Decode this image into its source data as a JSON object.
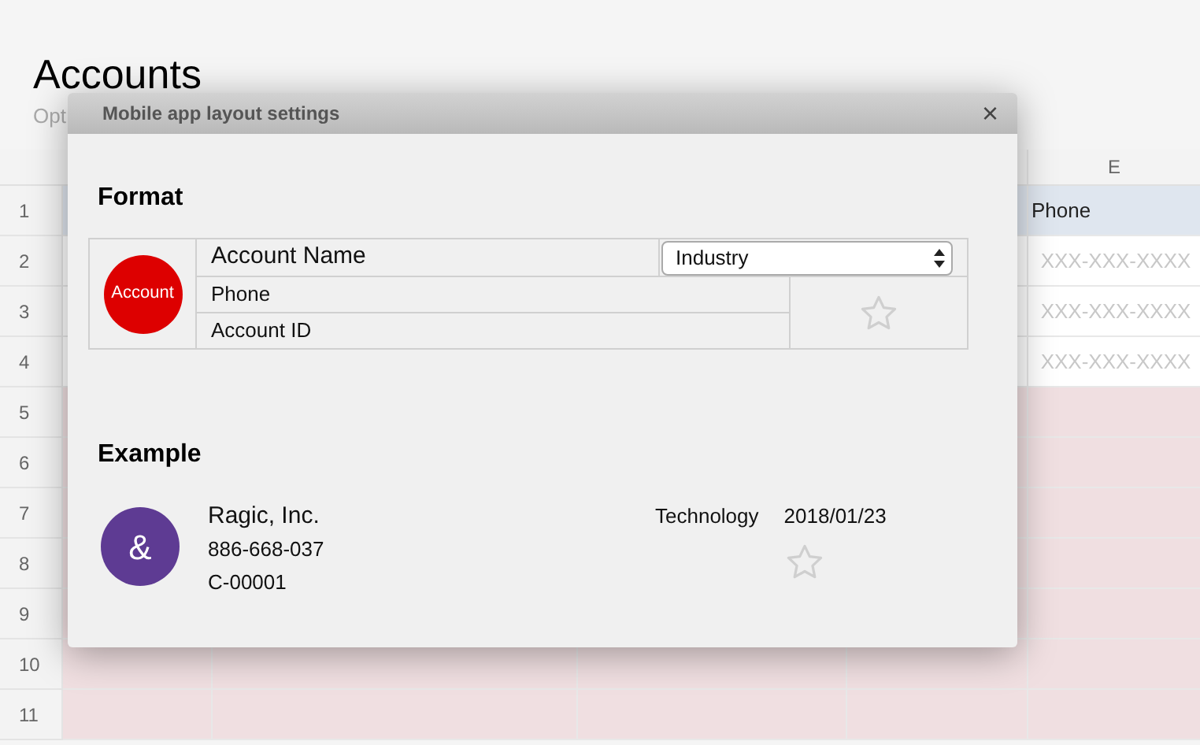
{
  "page": {
    "title": "Accounts",
    "subtitle": "Opt"
  },
  "sheet": {
    "column_header": "E",
    "rows": [
      {
        "number": "1",
        "kind": "heading",
        "text": "Phone"
      },
      {
        "number": "2",
        "kind": "placeholder",
        "text": "XXX-XXX-XXXX"
      },
      {
        "number": "3",
        "kind": "placeholder",
        "text": "XXX-XXX-XXXX"
      },
      {
        "number": "4",
        "kind": "placeholder",
        "text": "XXX-XXX-XXXX"
      },
      {
        "number": "5",
        "kind": "blank"
      },
      {
        "number": "6",
        "kind": "blank"
      },
      {
        "number": "7",
        "kind": "blank"
      },
      {
        "number": "8",
        "kind": "blank"
      },
      {
        "number": "9",
        "kind": "blank"
      },
      {
        "number": "10",
        "kind": "blank"
      },
      {
        "number": "11",
        "kind": "blank"
      }
    ]
  },
  "dialog": {
    "title": "Mobile app layout settings",
    "close": "×",
    "format": {
      "heading": "Format",
      "avatar": {
        "text": "Account",
        "color": "#dd0000"
      },
      "field_1": "Account Name",
      "select": "Industry",
      "field_2": "Phone",
      "field_3": "Account ID"
    },
    "example": {
      "heading": "Example",
      "avatar": {
        "text": "&",
        "color": "#5e3b93"
      },
      "line_1": "Ragic, Inc.",
      "line_2": "886-668-037",
      "line_3": "C-00001",
      "industry": "Technology",
      "date": "2018/01/23"
    }
  }
}
